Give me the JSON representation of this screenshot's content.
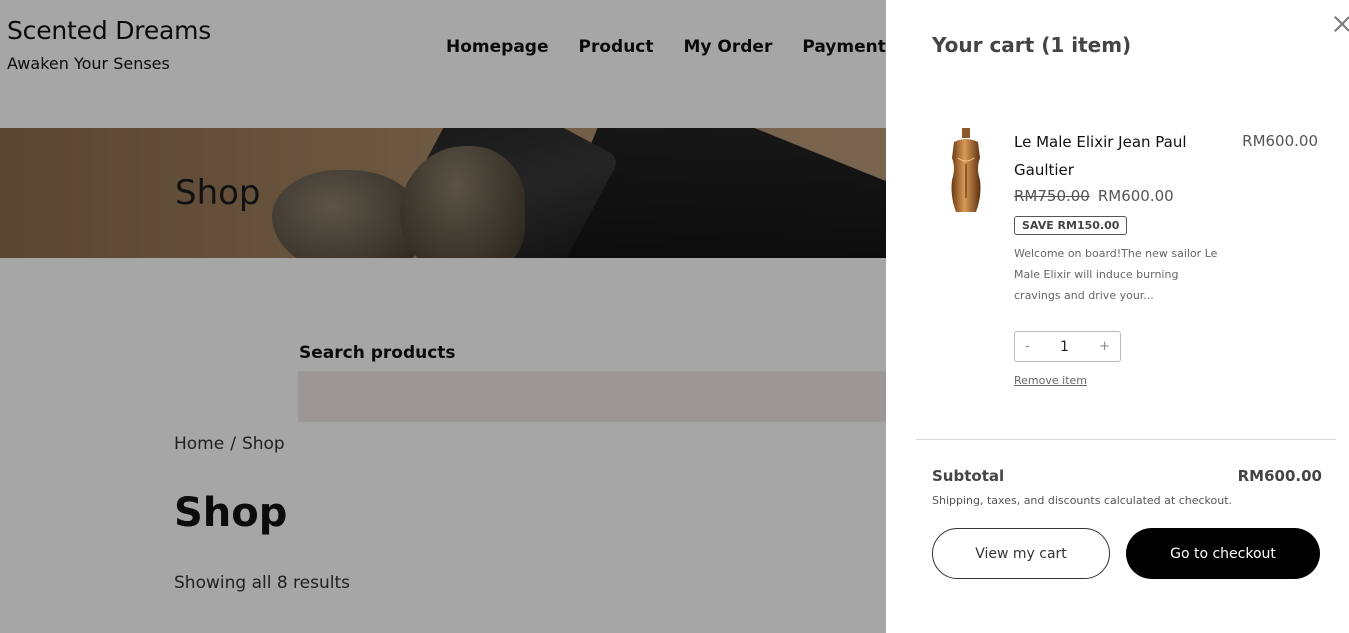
{
  "site": {
    "title": "Scented Dreams",
    "tagline": "Awaken Your Senses"
  },
  "nav": [
    {
      "label": "Homepage"
    },
    {
      "label": "Product"
    },
    {
      "label": "My Order"
    },
    {
      "label": "Payment"
    }
  ],
  "banner": {
    "title": "Shop"
  },
  "search": {
    "label": "Search products",
    "value": ""
  },
  "breadcrumb": {
    "home": "Home",
    "separator": "/",
    "current": "Shop"
  },
  "main": {
    "title": "Shop",
    "results": "Showing all 8 results"
  },
  "cart": {
    "title": "Your cart (1 item)",
    "close_icon": "close-icon",
    "item": {
      "name": "Le Male Elixir Jean Paul Gaultier",
      "line_price": "RM600.00",
      "old_price": "RM750.00",
      "price": "RM600.00",
      "save_badge": "SAVE RM150.00",
      "description": "Welcome on board!The new sailor Le Male Elixir will induce burning cravings and drive your...",
      "quantity": "1",
      "qty_minus": "-",
      "qty_plus": "+",
      "remove": "Remove item"
    },
    "subtotal_label": "Subtotal",
    "subtotal_value": "RM600.00",
    "shipping_note": "Shipping, taxes, and discounts calculated at checkout.",
    "view_cart": "View my cart",
    "checkout": "Go to checkout"
  }
}
